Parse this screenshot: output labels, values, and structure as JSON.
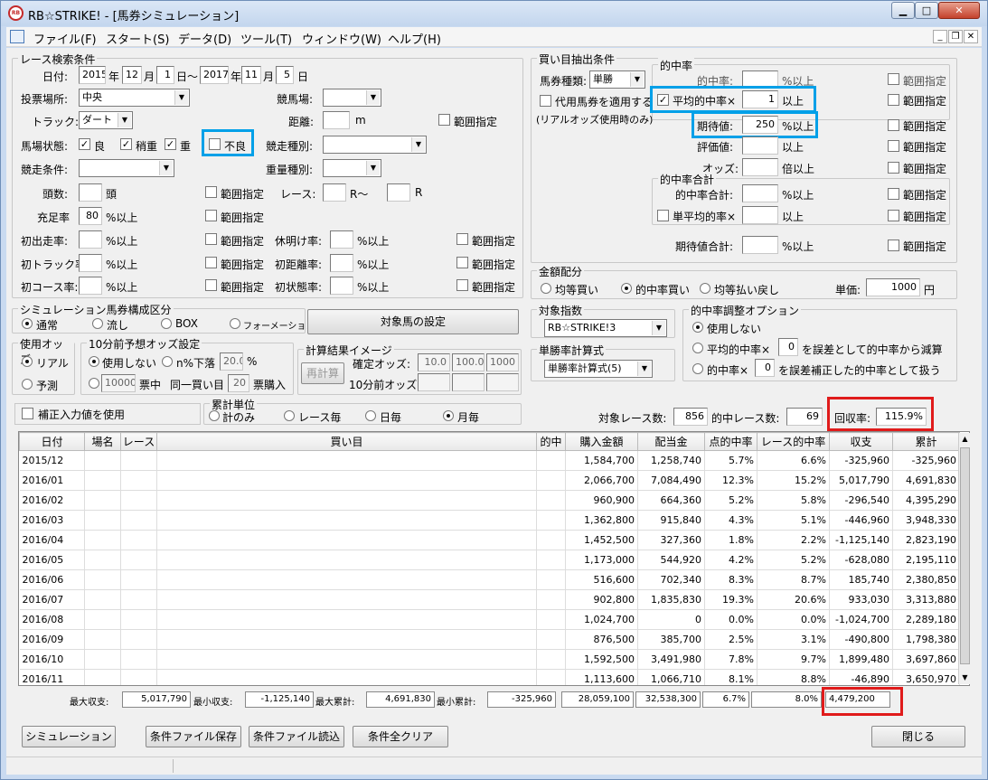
{
  "window": {
    "title": "RB☆STRIKE! - [馬券シミュレーション]",
    "logo": "RB"
  },
  "menu": {
    "file": "ファイル(F)",
    "start": "スタート(S)",
    "data": "データ(D)",
    "tool": "ツール(T)",
    "window": "ウィンドウ(W)",
    "help": "ヘルプ(H)"
  },
  "race": {
    "legend": "レース検索条件",
    "date_label": "日付:",
    "from_year": "2015",
    "from_month": "12",
    "from_day": "1",
    "to_year": "2017",
    "to_month": "11",
    "to_day": "5",
    "u_year": "年",
    "u_month": "月",
    "u_day_to": "日～",
    "u_day": "日",
    "venue_label": "投票場所:",
    "venue_value": "中央",
    "keibajo_label": "競馬場:",
    "track_label": "トラック:",
    "track_value": "ダート",
    "distance_label": "距離:",
    "distance_unit": "m",
    "range": "範囲指定",
    "baba_label": "馬場状態:",
    "baba_good": "良",
    "baba_yayaomo": "稍重",
    "baba_omo": "重",
    "baba_furyo": "不良",
    "kyoso_shubetsu_label": "競走種別:",
    "kyoso_joken_label": "競走条件:",
    "juryo_label": "重量種別:",
    "tosu_label": "頭数:",
    "tosu_unit": "頭",
    "race_label": "レース:",
    "race_from_unit": "R～",
    "race_to_unit": "R",
    "juten_label": "充足率",
    "juten_value": "80",
    "pct_over": "%以上",
    "shoshutsu_label": "初出走率:",
    "kyumei_label": "休明け率:",
    "shotrack_label": "初トラック率:",
    "shokyori_label": "初距離率:",
    "shocourse_label": "初コース率:",
    "shojotai_label": "初状態率:"
  },
  "buy": {
    "legend": "買い目抽出条件",
    "baken_label": "馬券種類:",
    "baken_value": "単勝",
    "daiyo_label": "代用馬券を適用する",
    "daiyo_note": "(リアルオッズ使用時のみ)",
    "tekichu_legend": "的中率",
    "tekichu_label": "的中率:",
    "pct_over": "%以上",
    "ijo": "以上",
    "avg_label": "平均的中率×",
    "avg_value": "1",
    "kitai_label": "期待値:",
    "kitai_value": "250",
    "hyoka_label": "評価値:",
    "odds_label": "オッズ:",
    "odds_unit": "倍以上",
    "range": "範囲指定",
    "goukei_legend": "的中率合計",
    "goukei_label": "的中率合計:",
    "tanheikin_label": "単平均的率×",
    "kitai_goukei_label": "期待値合計:"
  },
  "kingaku": {
    "legend": "金額配分",
    "opt1": "均等買い",
    "opt2": "的中率買い",
    "opt3": "均等払い戻し",
    "tanka_label": "単価:",
    "tanka_value": "1000",
    "tanka_unit": "円"
  },
  "shisu": {
    "legend": "対象指数",
    "value": "RB☆STRIKE!3"
  },
  "shoritsu": {
    "legend": "単勝率計算式",
    "value": "単勝率計算式(5)"
  },
  "tekichu_adj": {
    "legend": "的中率調整オプション",
    "opt1": "使用しない",
    "opt2a": "平均的中率×",
    "opt2_value": "0",
    "opt2b": "を誤差として的中率から減算",
    "opt3a": "的中率×",
    "opt3_value": "0",
    "opt3b": "を誤差補正した的中率として扱う"
  },
  "sim": {
    "legend": "シミュレーション馬券構成区分",
    "opt1": "通常",
    "opt2": "流し",
    "opt3": "BOX",
    "opt4": "フォーメーション",
    "target_button": "対象馬の設定"
  },
  "odds_use": {
    "legend": "使用オッズ",
    "opt1": "リアル",
    "opt2": "予測"
  },
  "odds10": {
    "legend": "10分前予想オッズ設定",
    "opt1": "使用しない",
    "opt2": "n%下落",
    "pct_value": "20.0",
    "pct": "%",
    "buy_value": "10000",
    "buy_unit": "票中",
    "same_label": "同一買い目",
    "same_value": "20",
    "same_unit": "票購入"
  },
  "calc": {
    "legend": "計算結果イメージ",
    "recalc": "再計算",
    "kakutei_label": "確定オッズ:",
    "k1": "10.0",
    "k2": "100.0",
    "k3": "1000",
    "min10_label": "10分前オッズ:"
  },
  "hosei": {
    "label": "補正入力値を使用"
  },
  "shukei": {
    "legend": "累計単位",
    "opt1": "計のみ",
    "opt2": "レース毎",
    "opt3": "日毎",
    "opt4": "月毎"
  },
  "stats": {
    "race_count_label": "対象レース数:",
    "race_count": "856",
    "hit_label": "的中レース数:",
    "hit_count": "69",
    "recovery_label": "回収率:",
    "recovery_value": "115.9%"
  },
  "table": {
    "headers": [
      "日付",
      "場名",
      "レース",
      "買い目",
      "的中",
      "購入金額",
      "配当金",
      "点的中率",
      "レース的中率",
      "収支",
      "累計"
    ],
    "rows": [
      [
        "2015/12",
        "",
        "",
        "",
        "",
        "1,584,700",
        "1,258,740",
        "5.7%",
        "6.6%",
        "-325,960",
        "-325,960"
      ],
      [
        "2016/01",
        "",
        "",
        "",
        "",
        "2,066,700",
        "7,084,490",
        "12.3%",
        "15.2%",
        "5,017,790",
        "4,691,830"
      ],
      [
        "2016/02",
        "",
        "",
        "",
        "",
        "960,900",
        "664,360",
        "5.2%",
        "5.8%",
        "-296,540",
        "4,395,290"
      ],
      [
        "2016/03",
        "",
        "",
        "",
        "",
        "1,362,800",
        "915,840",
        "4.3%",
        "5.1%",
        "-446,960",
        "3,948,330"
      ],
      [
        "2016/04",
        "",
        "",
        "",
        "",
        "1,452,500",
        "327,360",
        "1.8%",
        "2.2%",
        "-1,125,140",
        "2,823,190"
      ],
      [
        "2016/05",
        "",
        "",
        "",
        "",
        "1,173,000",
        "544,920",
        "4.2%",
        "5.2%",
        "-628,080",
        "2,195,110"
      ],
      [
        "2016/06",
        "",
        "",
        "",
        "",
        "516,600",
        "702,340",
        "8.3%",
        "8.7%",
        "185,740",
        "2,380,850"
      ],
      [
        "2016/07",
        "",
        "",
        "",
        "",
        "902,800",
        "1,835,830",
        "19.3%",
        "20.6%",
        "933,030",
        "3,313,880"
      ],
      [
        "2016/08",
        "",
        "",
        "",
        "",
        "1,024,700",
        "0",
        "0.0%",
        "0.0%",
        "-1,024,700",
        "2,289,180"
      ],
      [
        "2016/09",
        "",
        "",
        "",
        "",
        "876,500",
        "385,700",
        "2.5%",
        "3.1%",
        "-490,800",
        "1,798,380"
      ],
      [
        "2016/10",
        "",
        "",
        "",
        "",
        "1,592,500",
        "3,491,980",
        "7.8%",
        "9.7%",
        "1,899,480",
        "3,697,860"
      ],
      [
        "2016/11",
        "",
        "",
        "",
        "",
        "1,113,600",
        "1,066,710",
        "8.1%",
        "8.8%",
        "-46,890",
        "3,650,970"
      ]
    ]
  },
  "summary": {
    "max_shushi_label": "最大収支:",
    "max_shushi": "5,017,790",
    "min_shushi_label": "最小収支:",
    "min_shushi": "-1,125,140",
    "max_ruikei_label": "最大累計:",
    "max_ruikei": "4,691,830",
    "min_ruikei_label": "最小累計:",
    "min_ruikei": "-325,960",
    "total_buy": "28,059,100",
    "total_payout": "32,538,300",
    "total_ten": "6.7%",
    "total_race": "8.0%",
    "total_shushi": "4,479,200"
  },
  "buttons": {
    "simulate": "シミュレーション",
    "save": "条件ファイル保存",
    "load": "条件ファイル読込",
    "clear": "条件全クリア",
    "close": "閉じる"
  }
}
